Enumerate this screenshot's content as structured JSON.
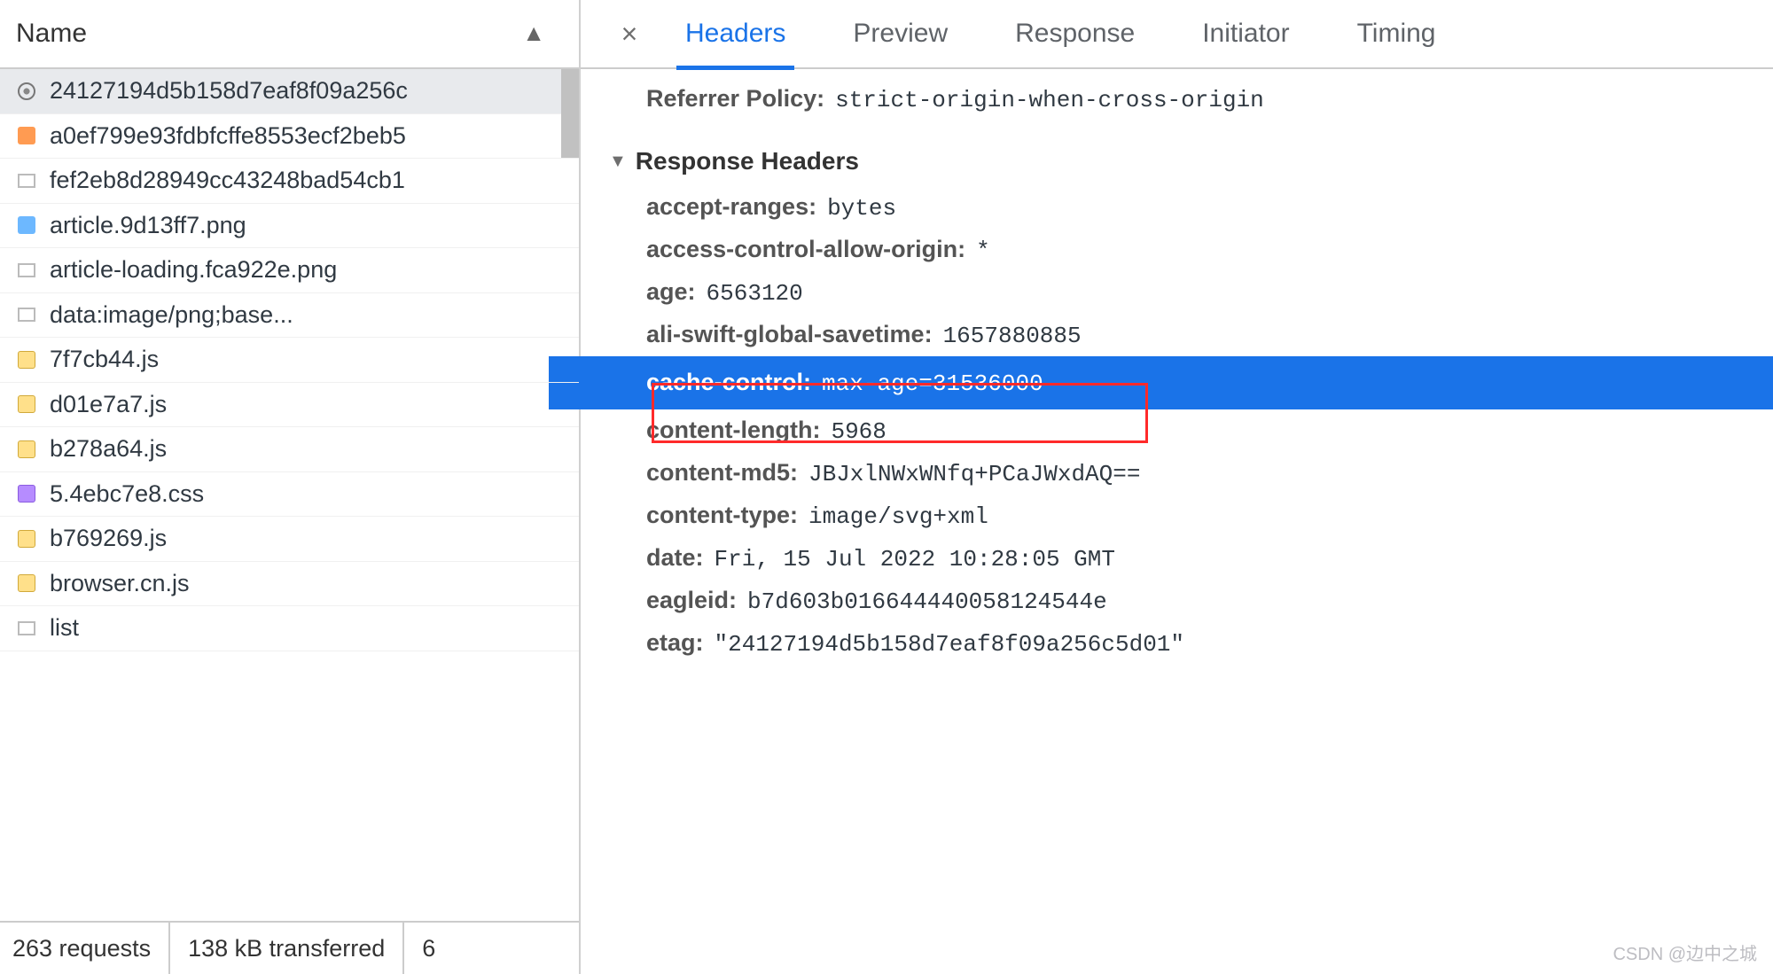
{
  "left": {
    "column_name": "Name",
    "files": [
      {
        "icon": "svg",
        "name": "24127194d5b158d7eaf8f09a256c"
      },
      {
        "icon": "img-o",
        "name": "a0ef799e93fdbfcffe8553ecf2beb5"
      },
      {
        "icon": "blank",
        "name": "fef2eb8d28949cc43248bad54cb1"
      },
      {
        "icon": "img-b",
        "name": "article.9d13ff7.png"
      },
      {
        "icon": "blank",
        "name": "article-loading.fca922e.png"
      },
      {
        "icon": "blank",
        "name": "data:image/png;base..."
      },
      {
        "icon": "js",
        "name": "7f7cb44.js"
      },
      {
        "icon": "js",
        "name": "d01e7a7.js"
      },
      {
        "icon": "js",
        "name": "b278a64.js"
      },
      {
        "icon": "css",
        "name": "5.4ebc7e8.css"
      },
      {
        "icon": "js",
        "name": "b769269.js"
      },
      {
        "icon": "js",
        "name": "browser.cn.js"
      },
      {
        "icon": "blank",
        "name": "list"
      }
    ],
    "status": {
      "requests": "263 requests",
      "transferred": "138 kB transferred",
      "extra": "6"
    }
  },
  "tabs": {
    "close": "×",
    "items": [
      "Headers",
      "Preview",
      "Response",
      "Initiator",
      "Timing"
    ],
    "active_index": 0
  },
  "top_kv": {
    "k": "Referrer Policy:",
    "v": "strict-origin-when-cross-origin"
  },
  "section_title": "Response Headers",
  "response_headers": [
    {
      "k": "accept-ranges:",
      "v": "bytes"
    },
    {
      "k": "access-control-allow-origin:",
      "v": "*"
    },
    {
      "k": "age:",
      "v": "6563120"
    },
    {
      "k": "ali-swift-global-savetime:",
      "v": "1657880885"
    },
    {
      "k": "cache-control:",
      "v": "max-age=31536000",
      "hl": true
    },
    {
      "k": "content-length:",
      "v": "5968"
    },
    {
      "k": "content-md5:",
      "v": "JBJxlNWxWNfq+PCaJWxdAQ=="
    },
    {
      "k": "content-type:",
      "v": "image/svg+xml"
    },
    {
      "k": "date:",
      "v": "Fri, 15 Jul 2022 10:28:05 GMT"
    },
    {
      "k": "eagleid:",
      "v": "b7d603b016644440058124544e"
    },
    {
      "k": "etag:",
      "v": "\"24127194d5b158d7eaf8f09a256c5d01\""
    }
  ],
  "watermark": "CSDN @边中之城"
}
